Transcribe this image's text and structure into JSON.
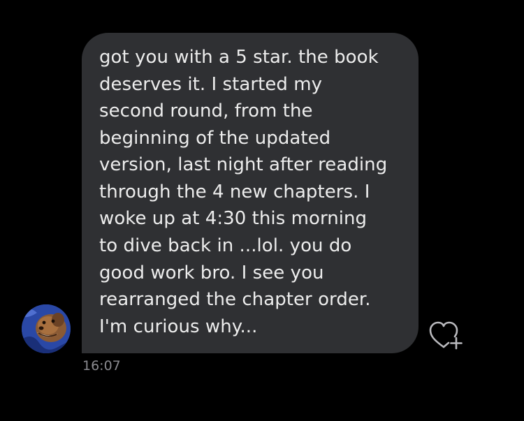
{
  "message": {
    "lines": [
      "got you with a 5 star. the book",
      "deserves it. I started my",
      "second round, from the",
      "beginning of the updated",
      "version, last night after reading",
      "through the 4 new chapters. I",
      "woke up at 4:30 this morning",
      "to dive back in ...lol.   you do",
      "good work bro. I see you",
      "rearranged the chapter order.",
      "I'm curious why..."
    ],
    "timestamp": "16:07"
  },
  "icons": {
    "like": "heart-plus-icon",
    "avatar": "avatar"
  },
  "colors": {
    "background": "#000000",
    "bubble": "#2f3033",
    "text": "#ededed",
    "timestamp": "#8a8a8f"
  }
}
